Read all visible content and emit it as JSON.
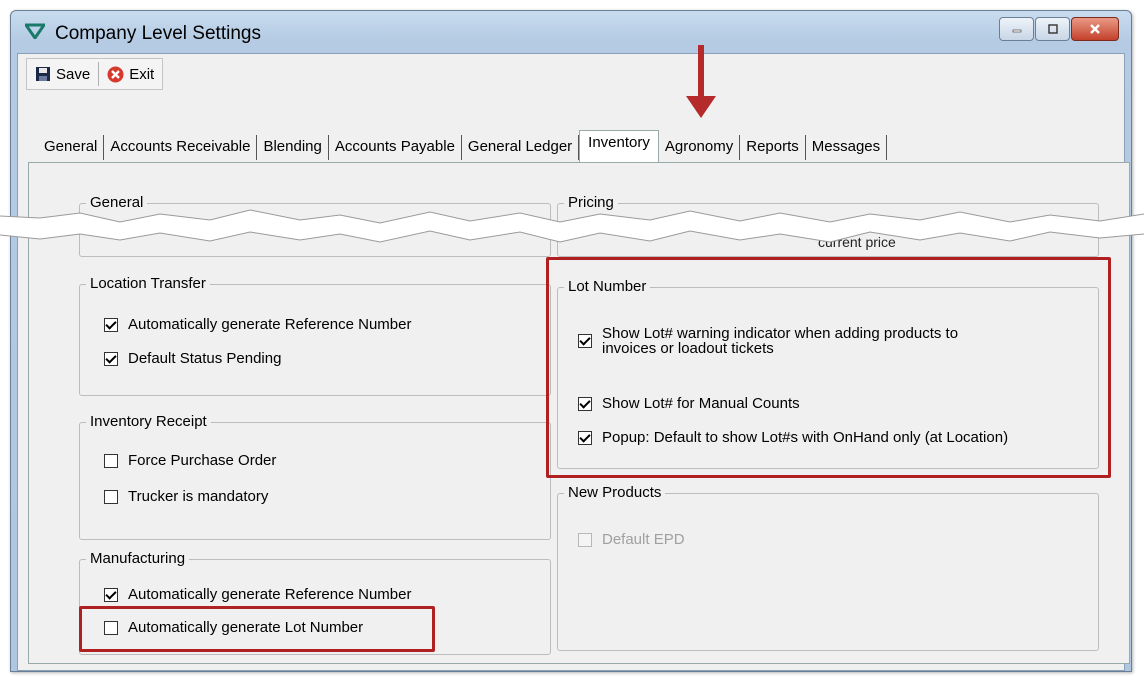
{
  "window": {
    "title": "Company Level Settings"
  },
  "toolbar": {
    "save_label": "Save",
    "exit_label": "Exit"
  },
  "tabs": [
    "General",
    "Accounts Receivable",
    "Blending",
    "Accounts Payable",
    "General Ledger",
    "Inventory",
    "Agronomy",
    "Reports",
    "Messages"
  ],
  "active_tab": "Inventory",
  "groups": {
    "general": {
      "title": "General"
    },
    "pricing": {
      "title": "Pricing",
      "partial_text": "current price"
    },
    "location_transfer": {
      "title": "Location Transfer",
      "items": [
        {
          "label": "Automatically generate Reference Number",
          "checked": true
        },
        {
          "label": "Default Status Pending",
          "checked": true
        }
      ]
    },
    "inventory_receipt": {
      "title": "Inventory Receipt",
      "items": [
        {
          "label": "Force Purchase Order",
          "checked": false
        },
        {
          "label": "Trucker is mandatory",
          "checked": false
        }
      ]
    },
    "manufacturing": {
      "title": "Manufacturing",
      "items": [
        {
          "label": "Automatically generate Reference Number",
          "checked": true
        },
        {
          "label": "Automatically generate Lot Number",
          "checked": false
        }
      ]
    },
    "lot_number": {
      "title": "Lot Number",
      "items": [
        {
          "label_line1": "Show Lot# warning indicator when adding products to",
          "label_line2": "invoices or loadout tickets",
          "checked": true
        },
        {
          "label": "Show Lot# for Manual Counts",
          "checked": true
        },
        {
          "label": "Popup: Default to show Lot#s with OnHand only (at Location)",
          "checked": true
        }
      ]
    },
    "new_products": {
      "title": "New Products",
      "items": [
        {
          "label": "Default EPD",
          "checked": false,
          "disabled": true
        }
      ]
    }
  },
  "colors": {
    "highlight": "#b02020",
    "arrow": "#b52a2a",
    "title_bar": "#b4cbe3"
  },
  "icons": [
    "app-logo-icon",
    "minimize-icon",
    "maximize-icon",
    "close-icon",
    "save-icon",
    "exit-icon"
  ]
}
